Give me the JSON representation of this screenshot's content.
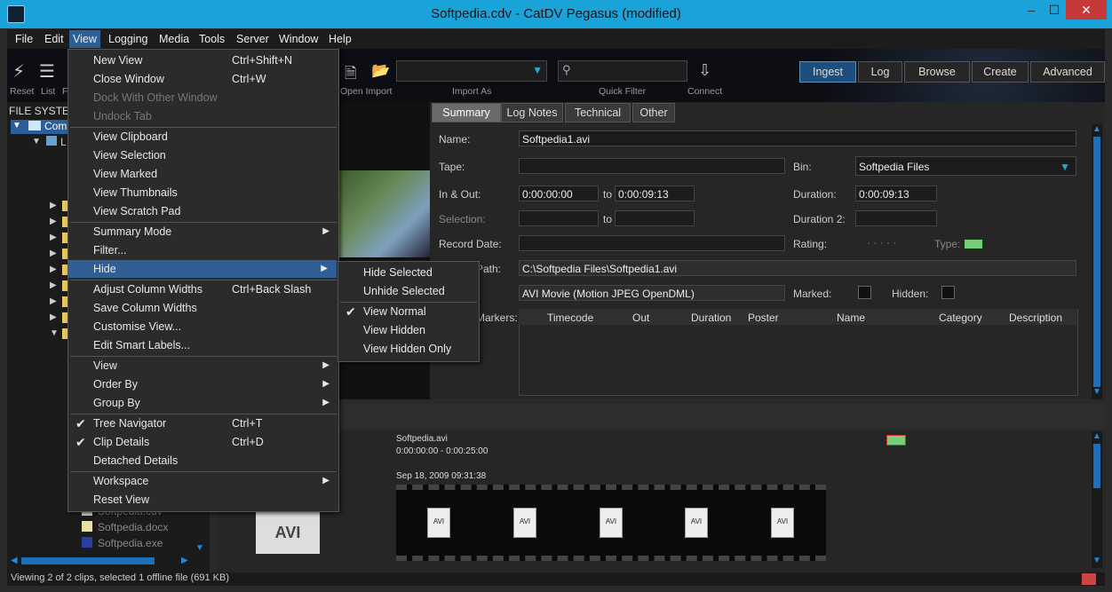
{
  "window": {
    "title": "Softpedia.cdv - CatDV Pegasus (modified)",
    "min": "–",
    "max": "☐",
    "close": "✕"
  },
  "menubar": [
    "File",
    "Edit",
    "View",
    "Logging",
    "Media",
    "Tools",
    "Server",
    "Window",
    "Help"
  ],
  "toolbar": {
    "reset": "Reset",
    "list": "List",
    "f": "F",
    "open_import": "Open Import",
    "import_as": "Import As",
    "quick_filter": "Quick Filter",
    "connect": "Connect",
    "modes": [
      "Ingest",
      "Log",
      "Browse",
      "Create",
      "Advanced"
    ]
  },
  "left": {
    "header": "FILE SYSTEM",
    "root": "Com",
    "sub": "L",
    "files": [
      "Softpedia.cdv",
      "Softpedia.docx",
      "Softpedia.exe"
    ]
  },
  "details": {
    "tabs": [
      "Summary",
      "Log Notes",
      "Technical",
      "Other"
    ],
    "name_label": "Name:",
    "name_value": "Softpedia1.avi",
    "tape_label": "Tape:",
    "bin_label": "Bin:",
    "bin_value": "Softpedia Files",
    "inout_label": "In & Out:",
    "in_value": "0:00:00:00",
    "to1": "to",
    "out_value": "0:00:09:13",
    "duration_label": "Duration:",
    "duration_value": "0:00:09:13",
    "selection_label": "Selection:",
    "to2": "to",
    "duration2_label": "Duration 2:",
    "record_label": "Record Date:",
    "rating_label": "Rating:",
    "rating_dots": "· · · · ·",
    "type_label": "Type:",
    "path_label": "Path:",
    "path_value": "C:\\Softpedia Files\\Softpedia1.avi",
    "format_value": "AVI Movie (Motion JPEG OpenDML)",
    "marked_label": "Marked:",
    "hidden_label": "Hidden:",
    "markers_label": "Markers:",
    "marker_cols": [
      "Timecode",
      "Out",
      "Duration",
      "Poster",
      "Name",
      "Category",
      "Description"
    ]
  },
  "bottom": {
    "clip_name": "Softpedia.avi",
    "clip_range": "0:00:00:00 - 0:00:25:00",
    "clip_date": "Sep 18, 2009 09:31:38",
    "frame_label": "AVI"
  },
  "status": "Viewing 2 of 2 clips, selected 1 offline file (691 KB)",
  "view_menu": [
    {
      "label": "New View",
      "shortcut": "Ctrl+Shift+N"
    },
    {
      "label": "Close Window",
      "shortcut": "Ctrl+W"
    },
    {
      "label": "Dock With Other Window",
      "disabled": true
    },
    {
      "label": "Undock Tab",
      "disabled": true
    },
    {
      "label": "View Clipboard"
    },
    {
      "label": "View Selection"
    },
    {
      "label": "View Marked"
    },
    {
      "label": "View Thumbnails"
    },
    {
      "label": "View Scratch Pad"
    },
    {
      "label": "Summary Mode",
      "submenu": true
    },
    {
      "label": "Filter..."
    },
    {
      "label": "Hide",
      "submenu": true,
      "selected": true
    },
    {
      "label": "Adjust Column Widths",
      "shortcut": "Ctrl+Back Slash"
    },
    {
      "label": "Save Column Widths"
    },
    {
      "label": "Customise View..."
    },
    {
      "label": "Edit Smart Labels..."
    },
    {
      "label": "View",
      "submenu": true
    },
    {
      "label": "Order By",
      "submenu": true
    },
    {
      "label": "Group By",
      "submenu": true
    },
    {
      "label": "Tree Navigator",
      "shortcut": "Ctrl+T",
      "checked": true
    },
    {
      "label": "Clip Details",
      "shortcut": "Ctrl+D",
      "checked": true
    },
    {
      "label": "Detached Details"
    },
    {
      "label": "Workspace",
      "submenu": true
    },
    {
      "label": "Reset View"
    }
  ],
  "hide_submenu": [
    {
      "label": "Hide Selected"
    },
    {
      "label": "Unhide Selected"
    },
    {
      "label": "View Normal",
      "checked": true
    },
    {
      "label": "View Hidden"
    },
    {
      "label": "View Hidden Only"
    }
  ],
  "icons": {
    "check": "✔",
    "submenu": "▶",
    "dropdown": "▼",
    "search": "⚲"
  },
  "colors": {
    "accent": "#1aa3d8",
    "selection": "#2f5f94",
    "active_mode": "#1c4e7e"
  }
}
